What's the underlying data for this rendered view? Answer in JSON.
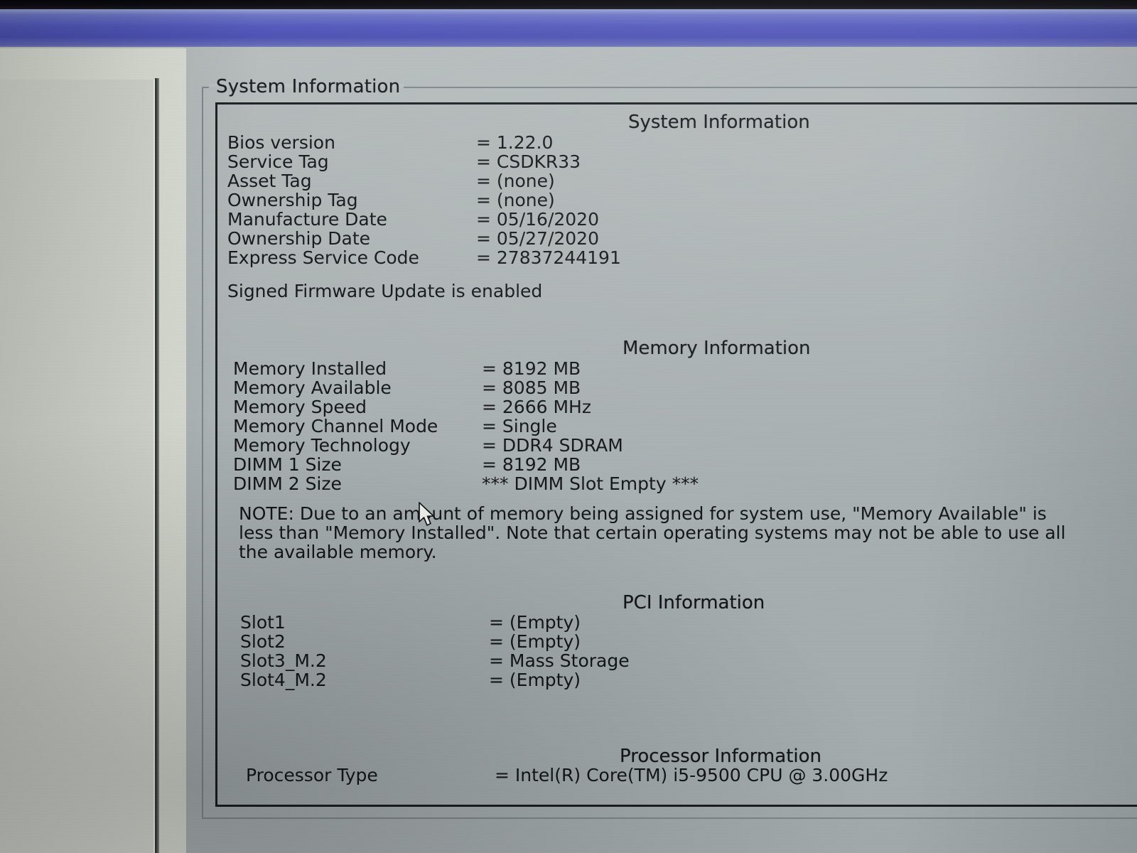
{
  "window": {
    "groupbox_label": "System Information"
  },
  "sections": [
    {
      "id": "system-information",
      "heading": "System Information",
      "rows": [
        {
          "key": "Bios version",
          "value": "= 1.22.0"
        },
        {
          "key": "Service Tag",
          "value": "= CSDKR33"
        },
        {
          "key": "Asset Tag",
          "value": "= (none)"
        },
        {
          "key": "Ownership Tag",
          "value": "= (none)"
        },
        {
          "key": "Manufacture Date",
          "value": "= 05/16/2020"
        },
        {
          "key": "Ownership Date",
          "value": "= 05/27/2020"
        },
        {
          "key": "Express Service Code",
          "value": "= 27837244191"
        }
      ],
      "note": "Signed Firmware Update is enabled"
    },
    {
      "id": "memory-information",
      "heading": "Memory Information",
      "rows": [
        {
          "key": "Memory Installed",
          "value": "= 8192 MB"
        },
        {
          "key": "Memory Available",
          "value": "= 8085 MB"
        },
        {
          "key": "Memory Speed",
          "value": "= 2666 MHz"
        },
        {
          "key": "Memory Channel Mode",
          "value": "= Single"
        },
        {
          "key": "Memory Technology",
          "value": "= DDR4 SDRAM"
        },
        {
          "key": "DIMM 1 Size",
          "value": "= 8192 MB"
        },
        {
          "key": "DIMM 2 Size",
          "value": "*** DIMM Slot Empty ***"
        }
      ],
      "note": "NOTE: Due to an amount of memory being assigned for system use, \"Memory Available\" is less than \"Memory Installed\". Note that certain operating systems may not be able to use all the available memory."
    },
    {
      "id": "pci-information",
      "heading": "PCI Information",
      "rows": [
        {
          "key": "Slot1",
          "value": "= (Empty)"
        },
        {
          "key": "Slot2",
          "value": "= (Empty)"
        },
        {
          "key": "Slot3_M.2",
          "value": "= Mass Storage"
        },
        {
          "key": "Slot4_M.2",
          "value": "= (Empty)"
        }
      ]
    },
    {
      "id": "processor-information",
      "heading": "Processor Information",
      "rows": [
        {
          "key": "Processor Type",
          "value": "= Intel(R) Core(TM) i5-9500 CPU @ 3.00GHz"
        }
      ]
    }
  ],
  "pointer": {
    "name": "mouse-arrow-cursor"
  },
  "colors": {
    "titlebar_blue": "#5157bb",
    "panel_grey": "#adb4b5",
    "text": "#121517",
    "border_dark": "#181c1e"
  }
}
